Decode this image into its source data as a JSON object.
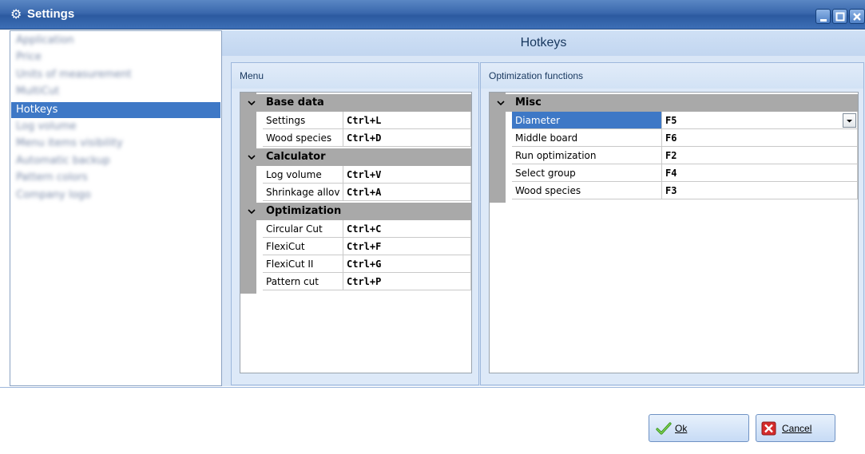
{
  "window": {
    "title": "Settings",
    "accent": "#3e78c6"
  },
  "sidebar": {
    "items": [
      {
        "label": "Application",
        "blurred": true
      },
      {
        "label": "Price",
        "blurred": true
      },
      {
        "label": "Units of measurement",
        "blurred": true
      },
      {
        "label": "MultiCut",
        "blurred": true
      },
      {
        "label": "Hotkeys",
        "blurred": false,
        "selected": true
      },
      {
        "label": "Log volume",
        "blurred": true
      },
      {
        "label": "Menu items visibility",
        "blurred": true
      },
      {
        "label": "Automatic backup",
        "blurred": true
      },
      {
        "label": "Pattern colors",
        "blurred": true
      },
      {
        "label": "Company logo",
        "blurred": true
      }
    ]
  },
  "header": {
    "title": "Hotkeys"
  },
  "menu_panel": {
    "title": "Menu",
    "groups": [
      {
        "name": "Base data",
        "rows": [
          {
            "label": "Settings",
            "key": "Ctrl+L"
          },
          {
            "label": "Wood species",
            "key": "Ctrl+D"
          }
        ]
      },
      {
        "name": "Calculator",
        "rows": [
          {
            "label": "Log volume",
            "key": "Ctrl+V"
          },
          {
            "label": "Shrinkage allov",
            "key": "Ctrl+A"
          }
        ]
      },
      {
        "name": "Optimization",
        "rows": [
          {
            "label": "Circular Cut",
            "key": "Ctrl+C"
          },
          {
            "label": "FlexiCut",
            "key": "Ctrl+F"
          },
          {
            "label": "FlexiCut II",
            "key": "Ctrl+G"
          },
          {
            "label": "Pattern cut",
            "key": "Ctrl+P"
          }
        ]
      }
    ]
  },
  "optimization_panel": {
    "title": "Optimization functions",
    "groups": [
      {
        "name": "Misc",
        "rows": [
          {
            "label": "Diameter",
            "key": "F5",
            "selected": true
          },
          {
            "label": "Middle board",
            "key": "F6"
          },
          {
            "label": "Run optimization",
            "key": "F2"
          },
          {
            "label": "Select group",
            "key": "F4"
          },
          {
            "label": "Wood species",
            "key": "F3"
          }
        ]
      }
    ]
  },
  "buttons": {
    "ok": {
      "label": "Ok",
      "icon": "checkmark-icon"
    },
    "cancel": {
      "label": "Cancel",
      "icon": "red-x-icon"
    }
  }
}
